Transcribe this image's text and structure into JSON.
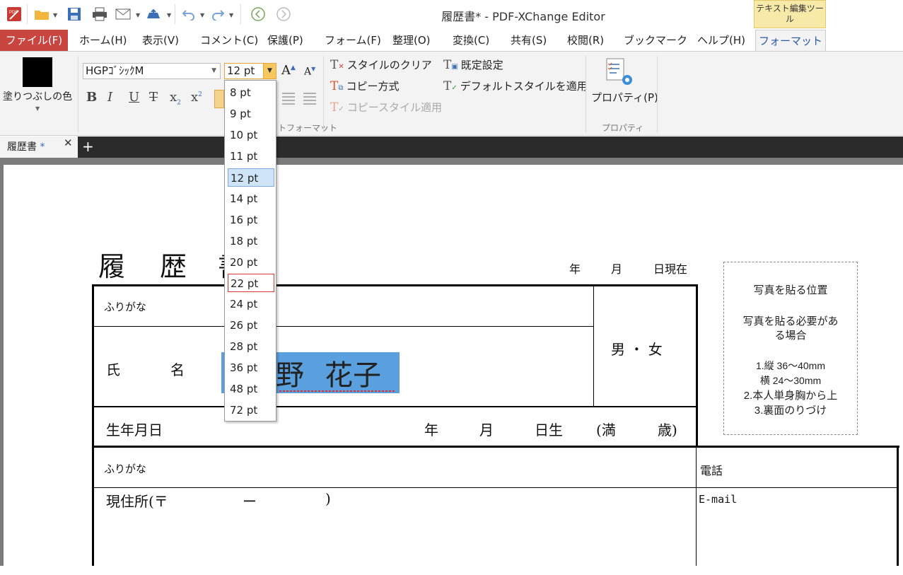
{
  "window": {
    "title": "履歴書* - PDF-XChange Editor",
    "context_tab_group": "テキスト編集ツール"
  },
  "ribbon_tabs": [
    "ファイル(F)",
    "ホーム(H)",
    "表示(V)",
    "コメント(C)",
    "保護(P)",
    "フォーム(F)",
    "整理(O)",
    "変換(C)",
    "共有(S)",
    "校閲(R)",
    "ブックマーク",
    "ヘルプ(H)",
    "フォーマット"
  ],
  "ribbon": {
    "fill_color_label": "塗りつぶしの色",
    "font_name": "HGPｺﾞｼｯｸM",
    "font_size": "12 pt",
    "group_text_format": "トフォーマット",
    "clear_style": "スタイルのクリア",
    "copy_method": "コピー方式",
    "copy_style_apply": "コピースタイル適用",
    "default_settings": "既定設定",
    "apply_default_style": "デフォルトスタイルを適用",
    "properties_button": "プロパティ(P)",
    "group_properties": "プロパティ",
    "fill_color": "#000000"
  },
  "font_size_options": [
    "8 pt",
    "9 pt",
    "10 pt",
    "11 pt",
    "12 pt",
    "14 pt",
    "16 pt",
    "18 pt",
    "20 pt",
    "22 pt",
    "24 pt",
    "26 pt",
    "28 pt",
    "36 pt",
    "48 pt",
    "72 pt"
  ],
  "font_size_selected": "12 pt",
  "font_size_hover": "22 pt",
  "doc_tab": {
    "label": "履歴書",
    "modified_marker": "*"
  },
  "document": {
    "title_chars": [
      "履",
      "歴",
      "書"
    ],
    "date_year": "年",
    "date_month": "月",
    "date_suffix": "日現在",
    "furigana_label": "ふりがな",
    "name_label_1": "氏",
    "name_label_2": "名",
    "name_value_1": "野",
    "name_value_2": "花子",
    "gender": "男 ・ 女",
    "birth_label": "生年月日",
    "birth_year": "年",
    "birth_month": "月",
    "birth_day": "日生",
    "age_open": "(満",
    "age_close": "歳)",
    "furigana_label_2": "ふりがな",
    "address_label": "現住所(〒",
    "address_dash": "ー",
    "address_close": ")",
    "phone_label": "電話",
    "email_label": "E-mail",
    "photo_box": {
      "title": "写真を貼る位置",
      "line1": "写真を貼る必要があ",
      "line2": "る場合",
      "line3": "1.縦  36〜40mm",
      "line4": "横  24〜30mm",
      "line5": "2.本人単身胸から上",
      "line6": "3.裏面のりづけ"
    },
    "selection_color": "#5aa0de"
  }
}
